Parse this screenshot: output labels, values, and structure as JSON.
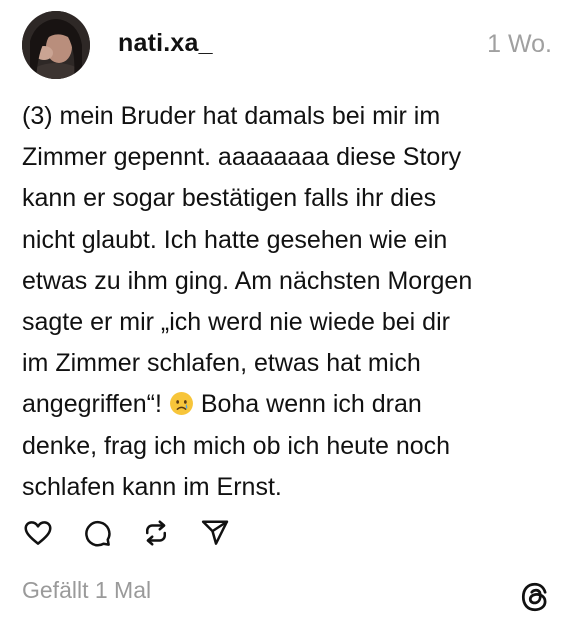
{
  "post": {
    "username": "nati.xa_",
    "time": "1 Wo.",
    "text_before_emoji": "(3) mein Bruder hat damals bei mir im\nZimmer gepennt. aaaaaaaa diese Story\nkann er sogar bestätigen falls ihr dies\nnicht glaubt. Ich hatte gesehen wie ein\netwas zu ihm ging. Am nächsten Morgen\nsagte er mir „ich werd nie wiede bei dir\nim Zimmer schlafen, etwas hat mich\nangegriffen“! ",
    "emoji": "crying-face",
    "text_after_emoji": " Boha wenn ich dran\ndenke, frag ich mich ob ich heute noch\nschlafen kann im Ernst.",
    "likes_text": "Gefällt 1 Mal"
  },
  "actions": [
    "heart-icon",
    "comment-icon",
    "repost-icon",
    "share-icon"
  ],
  "logo": "threads-logo",
  "colors": {
    "text": "#111111",
    "muted": "#a0a0a0",
    "background": "#ffffff"
  }
}
